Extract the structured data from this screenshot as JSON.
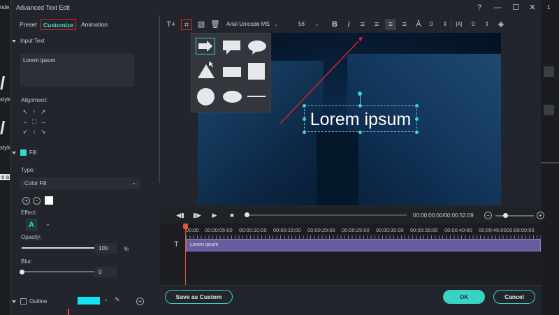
{
  "background": {
    "left_fragments": [
      "nde",
      "style",
      "style",
      "e a"
    ],
    "right_fragments": [
      "1"
    ]
  },
  "dialog": {
    "title": "Advanced Text Edit",
    "window_buttons": [
      "help-icon",
      "minimize-icon",
      "maximize-icon",
      "close-icon"
    ]
  },
  "left_panel": {
    "tabs": [
      {
        "label": "Preset",
        "active": false
      },
      {
        "label": "Customize",
        "active": true
      },
      {
        "label": "Animation",
        "active": false
      }
    ],
    "input_text_header": "Input Text",
    "input_text_value": "Lorem ipsum",
    "alignment_label": "Alignment:",
    "fill_label": "Fill",
    "fill_checked": true,
    "type_label": "Type:",
    "type_value": "Color Fill",
    "fill_color": "#ffffff",
    "effect_label": "Effect:",
    "opacity_label": "Opacity:",
    "opacity_value": "100",
    "opacity_unit": "%",
    "opacity_fraction": 1.0,
    "blur_label": "Blur:",
    "blur_value": "0",
    "blur_fraction": 0.0,
    "outline_label": "Outline",
    "outline_checked": false,
    "outline_color": "#11e4f0"
  },
  "toolbar": {
    "font_family": "Arial Unicode MS",
    "font_size": "56",
    "letter_spacing": "0",
    "line_spacing": "0",
    "selected_tool": "shape-tool",
    "active_alignment": "justify"
  },
  "shapes_popup": {
    "shapes": [
      "arrow",
      "speech-rect",
      "speech-oval",
      "triangle",
      "rectangle",
      "square",
      "circle",
      "ellipse",
      "line"
    ],
    "selected": "arrow"
  },
  "preview": {
    "text": "Lorem ipsum"
  },
  "transport": {
    "timecode": "00:00:00:00/00:00:52:09",
    "zoom_fraction": 0.25
  },
  "timeline": {
    "ruler": [
      "00:00",
      "00:00:05:00",
      "00:00:10:00",
      "00:00:15:00",
      "00:00:20:00",
      "00:00:25:00",
      "00:00:30:00",
      "00:00:35:00",
      "00:00:40:00",
      "00:00:45:00",
      "00:00:50:00"
    ],
    "clip_label": "Lorem ipsum"
  },
  "bottom": {
    "save_custom": "Save as Custom",
    "ok": "OK",
    "cancel": "Cancel"
  }
}
